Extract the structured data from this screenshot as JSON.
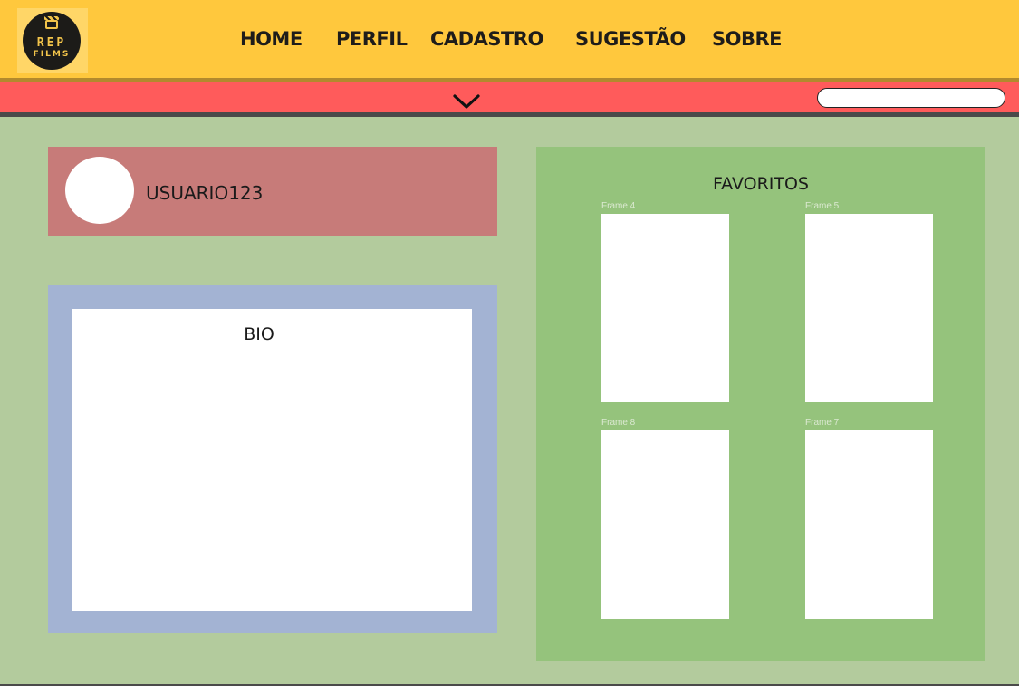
{
  "logo": {
    "line1": "REP",
    "line2": "FILMS"
  },
  "nav": {
    "home": "HOME",
    "perfil": "PERFIL",
    "cadastro": "CADASTRO",
    "sugestao": "SUGESTÃO",
    "sobre": "SOBRE"
  },
  "subbar": {
    "dropdown_icon": "chevron-down-icon",
    "search_placeholder": ""
  },
  "profile": {
    "username": "USUARIO123"
  },
  "bio": {
    "title": "BIO"
  },
  "favorites": {
    "title": "FAVORITOS",
    "frames": [
      {
        "label": "Frame 4"
      },
      {
        "label": "Frame 5"
      },
      {
        "label": "Frame 8"
      },
      {
        "label": "Frame 7"
      }
    ]
  },
  "colors": {
    "topbar": "#ffc83d",
    "subbar": "#ff5b5b",
    "background": "#b3cb9d",
    "user_card": "#c77b79",
    "bio_panel": "#a3b3d3",
    "favorites_panel": "#95c37c"
  }
}
